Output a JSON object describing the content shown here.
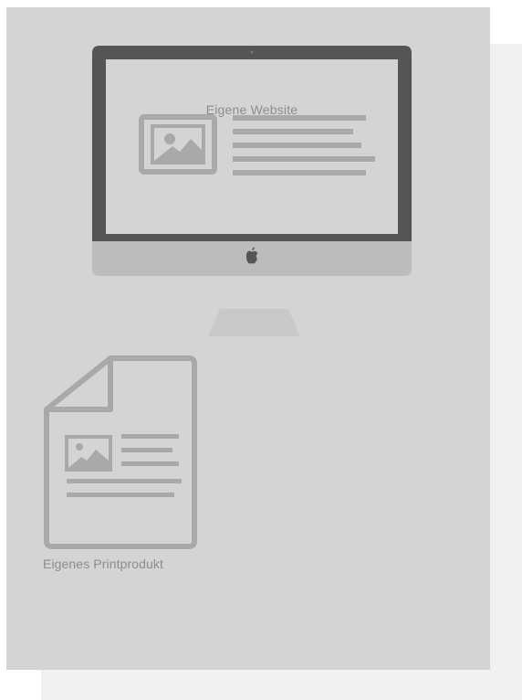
{
  "website_mockup": {
    "label": "Eigene Website",
    "brand_icon": "apple-logo-icon",
    "image_icon": "image-placeholder-icon"
  },
  "print_mockup": {
    "label": "Eigenes Printprodukt",
    "icon": "document-icon",
    "image_icon": "image-placeholder-icon"
  },
  "colors": {
    "card_front": "#d4d4d4",
    "card_back": "#f1f1f1",
    "icon_gray": "#a9a9a9",
    "bezel": "#555555",
    "label_gray": "#8d8d8d"
  }
}
